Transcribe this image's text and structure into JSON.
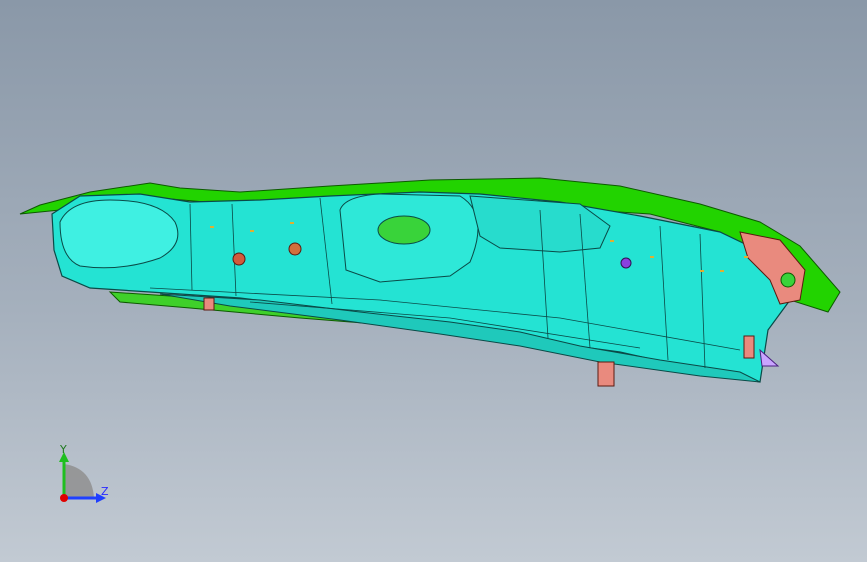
{
  "viewport": {
    "background_top": "#8a98a8",
    "background_bottom": "#c2cad3",
    "part_colors": {
      "main_body": "#24e3d3",
      "flange": "#22d300",
      "bracket": "#e98a7e",
      "highlight": "#c9a4ff",
      "hole_fill": "#39d33a"
    }
  },
  "triad": {
    "y_label": "Y",
    "z_label": "Z",
    "y_color": "#1fbf1f",
    "z_color": "#1f3fff",
    "x_color": "#e00000"
  }
}
